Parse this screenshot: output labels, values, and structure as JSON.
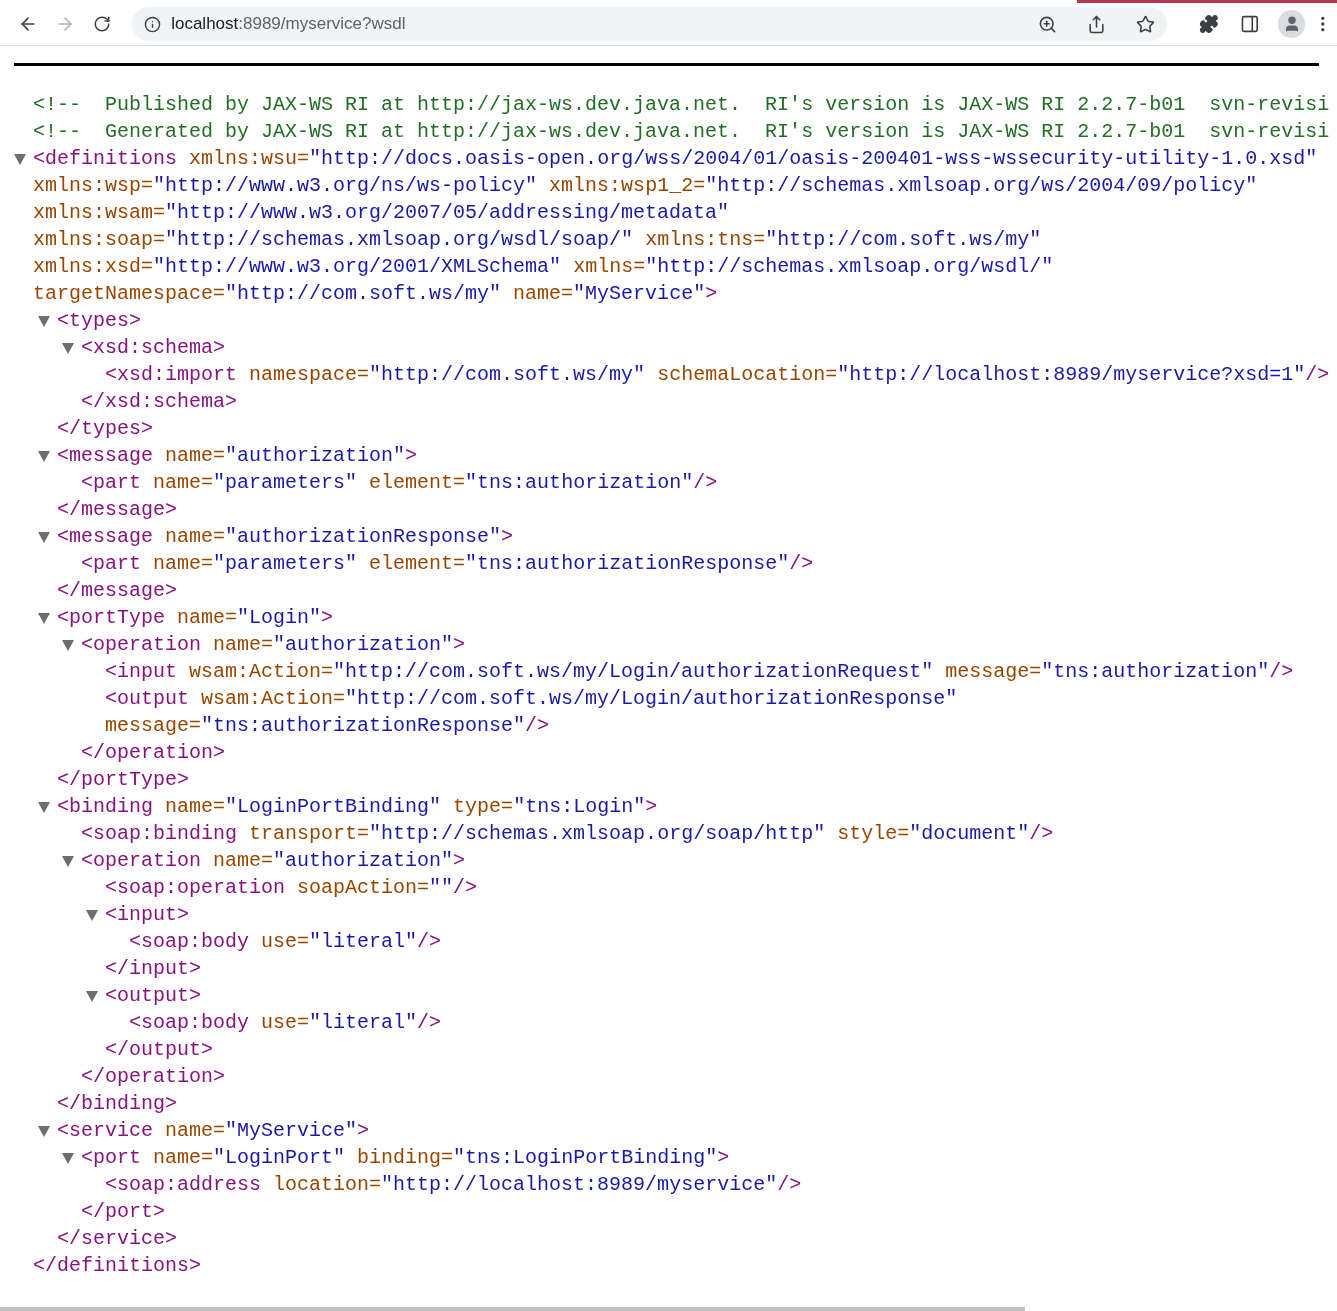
{
  "browser": {
    "url_host": "localhost",
    "url_path": ":8989/myservice?wsdl",
    "forward_disabled": true
  },
  "document": [
    {
      "kind": "comment",
      "text": "<!--  Published by JAX-WS RI at http://jax-ws.dev.java.net.  RI's version is JAX-WS RI 2.2.7-b01  svn-revisi"
    },
    {
      "kind": "comment",
      "text": "<!--  Generated by JAX-WS RI at http://jax-ws.dev.java.net.  RI's version is JAX-WS RI 2.2.7-b01  svn-revisi"
    },
    {
      "kind": "element",
      "open": "<definitions",
      "open_end": ">",
      "close": "</definitions>",
      "expanded": true,
      "attributes": [
        {
          "name": "xmlns:wsu=",
          "value": "\"http://docs.oasis-open.org/wss/2004/01/oasis-200401-wss-wssecurity-utility-1.0.xsd\""
        },
        {
          "name": "xmlns:wsp=",
          "value": "\"http://www.w3.org/ns/ws-policy\""
        },
        {
          "name": "xmlns:wsp1_2=",
          "value": "\"http://schemas.xmlsoap.org/ws/2004/09/policy\""
        },
        {
          "name": "xmlns:wsam=",
          "value": "\"http://www.w3.org/2007/05/addressing/metadata\""
        },
        {
          "name": "xmlns:soap=",
          "value": "\"http://schemas.xmlsoap.org/wsdl/soap/\""
        },
        {
          "name": "xmlns:tns=",
          "value": "\"http://com.soft.ws/my\""
        },
        {
          "name": "xmlns:xsd=",
          "value": "\"http://www.w3.org/2001/XMLSchema\""
        },
        {
          "name": "xmlns=",
          "value": "\"http://schemas.xmlsoap.org/wsdl/\""
        },
        {
          "name": "targetNamespace=",
          "value": "\"http://com.soft.ws/my\""
        },
        {
          "name": "name=",
          "value": "\"MyService\""
        }
      ],
      "children": [
        {
          "kind": "element",
          "open": "<types",
          "open_end": ">",
          "close": "</types>",
          "expanded": true,
          "children": [
            {
              "kind": "element",
              "open": "<xsd:schema",
              "open_end": ">",
              "close": "</xsd:schema>",
              "expanded": true,
              "children": [
                {
                  "kind": "element",
                  "open": "<xsd:import",
                  "open_end": "/>",
                  "attributes": [
                    {
                      "name": "namespace=",
                      "value": "\"http://com.soft.ws/my\""
                    },
                    {
                      "name": "schemaLocation=",
                      "value": "\"http://localhost:8989/myservice?xsd=1\""
                    }
                  ]
                }
              ]
            }
          ]
        },
        {
          "kind": "element",
          "open": "<message",
          "open_end": ">",
          "close": "</message>",
          "expanded": true,
          "attributes": [
            {
              "name": "name=",
              "value": "\"authorization\""
            }
          ],
          "children": [
            {
              "kind": "element",
              "open": "<part",
              "open_end": "/>",
              "attributes": [
                {
                  "name": "name=",
                  "value": "\"parameters\""
                },
                {
                  "name": "element=",
                  "value": "\"tns:authorization\""
                }
              ]
            }
          ]
        },
        {
          "kind": "element",
          "open": "<message",
          "open_end": ">",
          "close": "</message>",
          "expanded": true,
          "attributes": [
            {
              "name": "name=",
              "value": "\"authorizationResponse\""
            }
          ],
          "children": [
            {
              "kind": "element",
              "open": "<part",
              "open_end": "/>",
              "attributes": [
                {
                  "name": "name=",
                  "value": "\"parameters\""
                },
                {
                  "name": "element=",
                  "value": "\"tns:authorizationResponse\""
                }
              ]
            }
          ]
        },
        {
          "kind": "element",
          "open": "<portType",
          "open_end": ">",
          "close": "</portType>",
          "expanded": true,
          "attributes": [
            {
              "name": "name=",
              "value": "\"Login\""
            }
          ],
          "children": [
            {
              "kind": "element",
              "open": "<operation",
              "open_end": ">",
              "close": "</operation>",
              "expanded": true,
              "attributes": [
                {
                  "name": "name=",
                  "value": "\"authorization\""
                }
              ],
              "children": [
                {
                  "kind": "element",
                  "open": "<input",
                  "open_end": "/>",
                  "attributes": [
                    {
                      "name": "wsam:Action=",
                      "value": "\"http://com.soft.ws/my/Login/authorizationRequest\""
                    },
                    {
                      "name": "message=",
                      "value": "\"tns:authorization\""
                    }
                  ]
                },
                {
                  "kind": "element",
                  "open": "<output",
                  "open_end": "/>",
                  "attributes": [
                    {
                      "name": "wsam:Action=",
                      "value": "\"http://com.soft.ws/my/Login/authorizationResponse\""
                    },
                    {
                      "name": "message=",
                      "value": "\"tns:authorizationResponse\""
                    }
                  ]
                }
              ]
            }
          ]
        },
        {
          "kind": "element",
          "open": "<binding",
          "open_end": ">",
          "close": "</binding>",
          "expanded": true,
          "attributes": [
            {
              "name": "name=",
              "value": "\"LoginPortBinding\""
            },
            {
              "name": "type=",
              "value": "\"tns:Login\""
            }
          ],
          "children": [
            {
              "kind": "element",
              "open": "<soap:binding",
              "open_end": "/>",
              "attributes": [
                {
                  "name": "transport=",
                  "value": "\"http://schemas.xmlsoap.org/soap/http\""
                },
                {
                  "name": "style=",
                  "value": "\"document\""
                }
              ]
            },
            {
              "kind": "element",
              "open": "<operation",
              "open_end": ">",
              "close": "</operation>",
              "expanded": true,
              "attributes": [
                {
                  "name": "name=",
                  "value": "\"authorization\""
                }
              ],
              "children": [
                {
                  "kind": "element",
                  "open": "<soap:operation",
                  "open_end": "/>",
                  "attributes": [
                    {
                      "name": "soapAction=",
                      "value": "\"\""
                    }
                  ]
                },
                {
                  "kind": "element",
                  "open": "<input",
                  "open_end": ">",
                  "close": "</input>",
                  "expanded": true,
                  "children": [
                    {
                      "kind": "element",
                      "open": "<soap:body",
                      "open_end": "/>",
                      "attributes": [
                        {
                          "name": "use=",
                          "value": "\"literal\""
                        }
                      ]
                    }
                  ]
                },
                {
                  "kind": "element",
                  "open": "<output",
                  "open_end": ">",
                  "close": "</output>",
                  "expanded": true,
                  "children": [
                    {
                      "kind": "element",
                      "open": "<soap:body",
                      "open_end": "/>",
                      "attributes": [
                        {
                          "name": "use=",
                          "value": "\"literal\""
                        }
                      ]
                    }
                  ]
                }
              ]
            }
          ]
        },
        {
          "kind": "element",
          "open": "<service",
          "open_end": ">",
          "close": "</service>",
          "expanded": true,
          "attributes": [
            {
              "name": "name=",
              "value": "\"MyService\""
            }
          ],
          "children": [
            {
              "kind": "element",
              "open": "<port",
              "open_end": ">",
              "close": "</port>",
              "expanded": true,
              "attributes": [
                {
                  "name": "name=",
                  "value": "\"LoginPort\""
                },
                {
                  "name": "binding=",
                  "value": "\"tns:LoginPortBinding\""
                }
              ],
              "children": [
                {
                  "kind": "element",
                  "open": "<soap:address",
                  "open_end": "/>",
                  "attributes": [
                    {
                      "name": "location=",
                      "value": "\"http://localhost:8989/myservice\""
                    }
                  ]
                }
              ]
            }
          ]
        }
      ]
    }
  ]
}
